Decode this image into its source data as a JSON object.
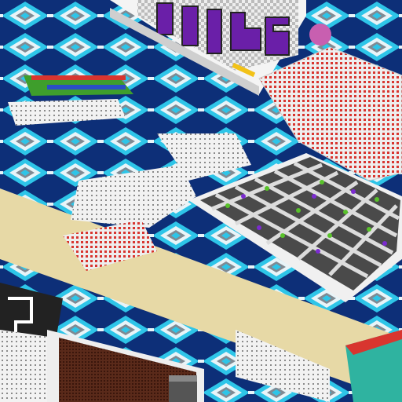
{
  "scene": {
    "type": "isometric voxel world",
    "palette": {
      "floor_dark": "#0d2f78",
      "floor_cyan": "#2ec5e8",
      "floor_white": "#e8f4f8",
      "floor_grey": "#7f8a93",
      "sand": "#e7d9a6",
      "board_light": "#dcdcdc",
      "board_dark": "#4a4a4a",
      "board_base": "#f0f0f0",
      "sign_purple": "#6a1fa8",
      "sign_black": "#222222",
      "seat_red": "#d8352f",
      "seat_green": "#3e9e2c",
      "seat_blue": "#2a4fc4",
      "piece_green": "#58c22a",
      "piece_purple": "#7b2bd0",
      "screen_brown": "#5a2a1a",
      "teal_trim": "#2fb3a0"
    }
  }
}
